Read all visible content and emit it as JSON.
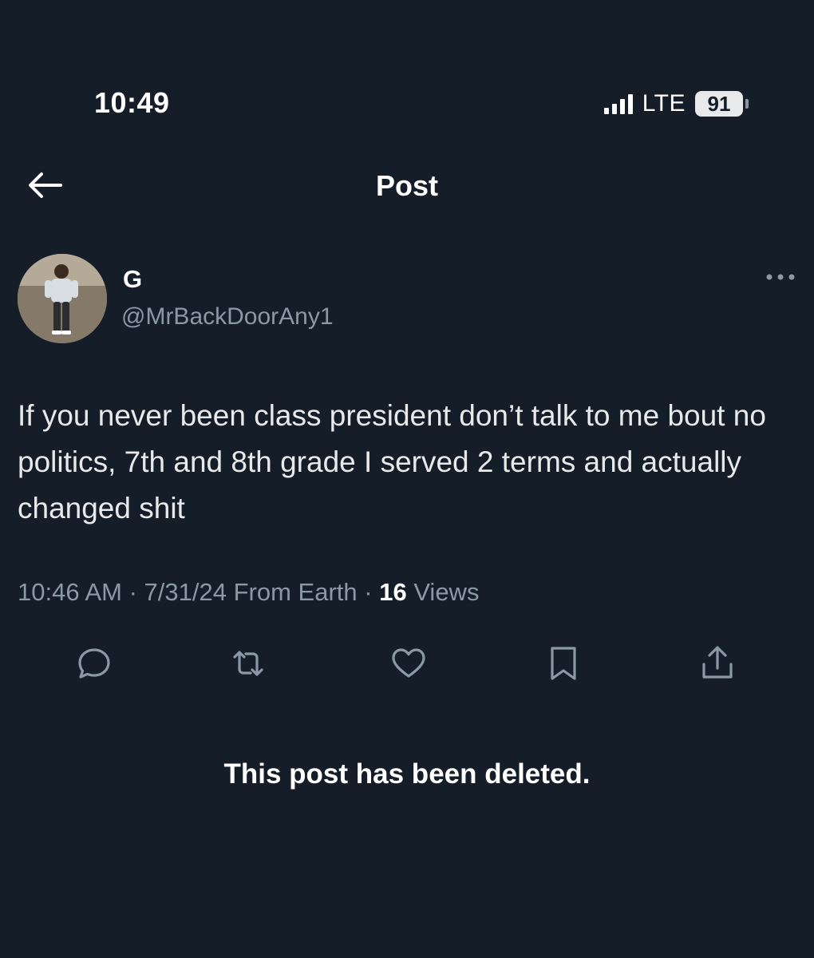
{
  "status_bar": {
    "time": "10:49",
    "network": "LTE",
    "battery": "91"
  },
  "nav": {
    "title": "Post"
  },
  "author": {
    "display_name": "G",
    "handle": "@MrBackDoorAny1"
  },
  "post": {
    "text": "If you never been class president don’t talk to me bout no politics, 7th and 8th grade I served 2 terms and actually changed shit",
    "time": "10:46 AM",
    "date": "7/31/24",
    "source": "From Earth",
    "views_count": "16",
    "views_label": "Views"
  },
  "actions": [
    {
      "icon": "reply-icon"
    },
    {
      "icon": "retweet-icon"
    },
    {
      "icon": "like-icon"
    },
    {
      "icon": "bookmark-icon"
    },
    {
      "icon": "share-icon"
    }
  ],
  "notice": "This post has been deleted.",
  "colors": {
    "background": "#151d28",
    "primary_text": "#e7e9ea",
    "secondary_text": "#8b98a5",
    "icon": "#8b98a5"
  }
}
